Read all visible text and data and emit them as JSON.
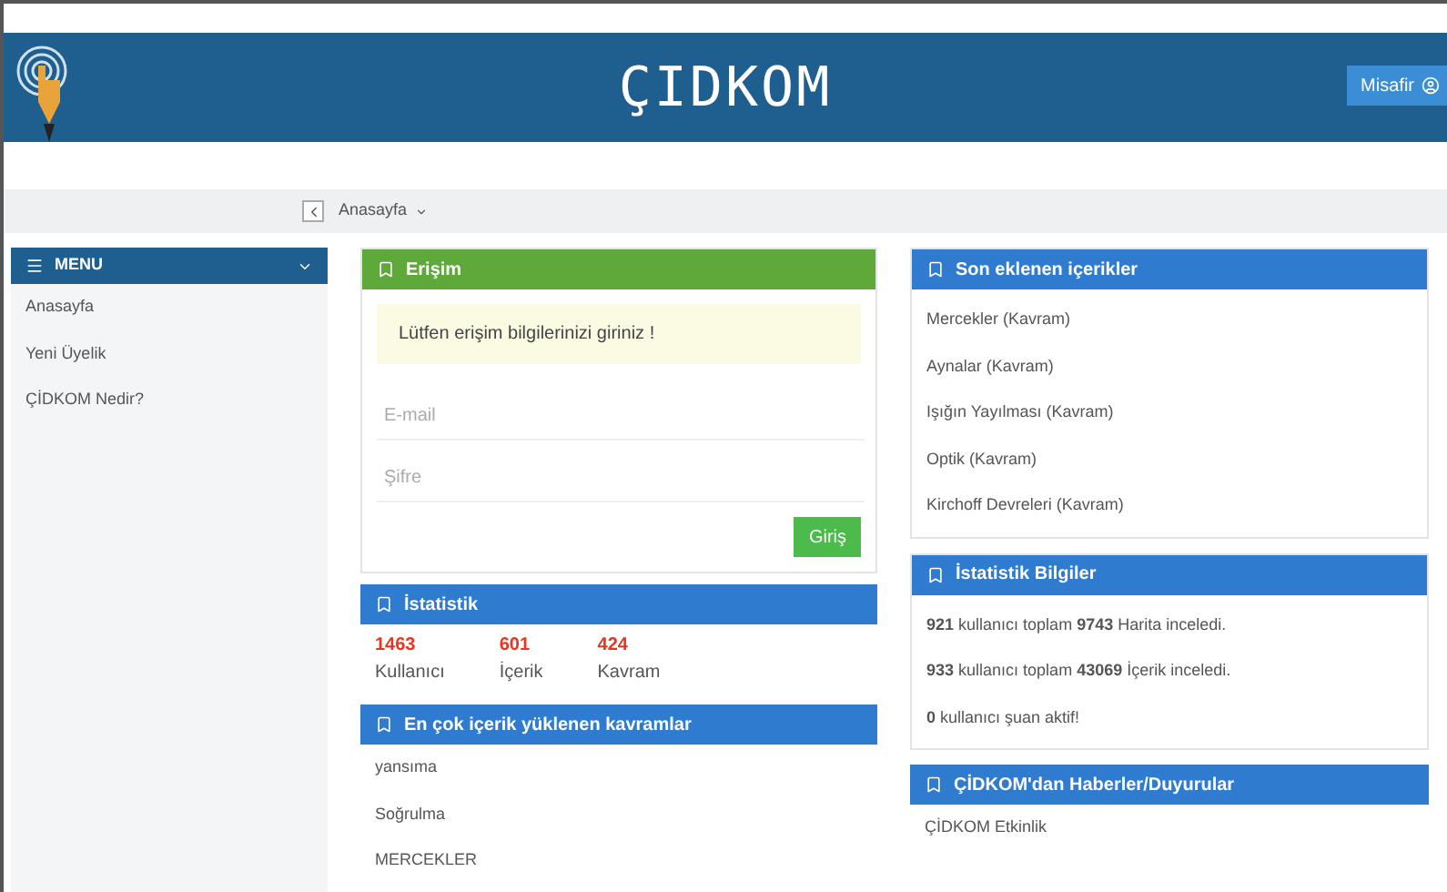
{
  "header": {
    "logo": "ÇIDKOM",
    "user_button": "Misafir"
  },
  "breadcrumb": {
    "items": [
      "Anasayfa"
    ]
  },
  "sidebar": {
    "title": "MENU",
    "items": [
      {
        "label": "Anasayfa"
      },
      {
        "label": "Yeni Üyelik"
      },
      {
        "label": "ÇİDKOM Nedir?"
      }
    ]
  },
  "login_panel": {
    "title": "Erişim",
    "alert": "Lütfen erişim bilgilerinizi giriniz !",
    "email": {
      "placeholder": "E-mail"
    },
    "password": {
      "placeholder": "Şifre"
    },
    "submit": "Giriş"
  },
  "stats_panel": {
    "title": "İstatistik",
    "stats": [
      {
        "value": "1463",
        "label": "Kullanıcı"
      },
      {
        "value": "601",
        "label": "İçerik"
      },
      {
        "value": "424",
        "label": "Kavram"
      }
    ]
  },
  "top_concepts_panel": {
    "title": "En çok içerik yüklenen kavramlar",
    "items": [
      "yansıma",
      "Soğrulma",
      "MERCEKLER"
    ]
  },
  "recent_panel": {
    "title": "Son eklenen içerikler",
    "items": [
      "Mercekler (Kavram)",
      "Aynalar (Kavram)",
      "Işığın Yayılması (Kavram)",
      "Optik (Kavram)",
      "Kirchoff Devreleri (Kavram)"
    ]
  },
  "stats_info_panel": {
    "title": "İstatistik Bilgiler",
    "lines": [
      "**921** kullanıcı toplam **9743** Harita inceledi.",
      "**933** kullanıcı toplam **43069** İçerik inceledi.",
      "**0** kullanıcı şuan aktif!"
    ]
  },
  "news_panel": {
    "title": "ÇİDKOM'dan Haberler/Duyurular",
    "items": [
      "ÇİDKOM Etkinlik"
    ]
  }
}
